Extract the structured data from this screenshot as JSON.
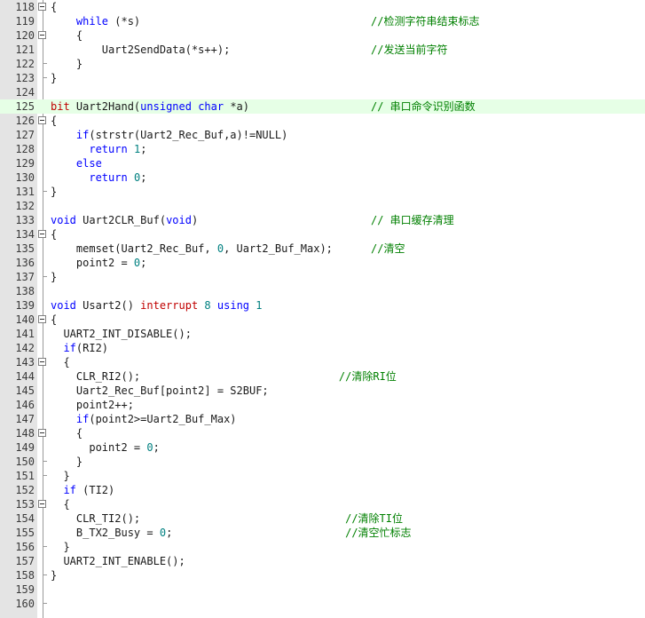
{
  "colors": {
    "keyword": "#0000ff",
    "keyword_red": "#c00000",
    "number": "#008080",
    "comment": "#008000",
    "highlight": "#e6ffe6",
    "gutter": "#e4e4e4"
  },
  "highlighted_line": 125,
  "lines": [
    {
      "n": "118",
      "fold": "open",
      "tokens": [
        {
          "t": "{"
        }
      ]
    },
    {
      "n": "119",
      "tokens": [
        {
          "t": "    "
        },
        {
          "t": "while",
          "c": "kw"
        },
        {
          "t": " (*s)"
        }
      ],
      "comment": "//检测字符串结束标志",
      "cc": 50
    },
    {
      "n": "120",
      "fold": "open",
      "tokens": [
        {
          "t": "    {"
        }
      ]
    },
    {
      "n": "121",
      "tokens": [
        {
          "t": "        Uart2SendData(*s++);"
        }
      ],
      "comment": "//发送当前字符",
      "cc": 50
    },
    {
      "n": "122",
      "fold": "end",
      "tokens": [
        {
          "t": "    }"
        }
      ]
    },
    {
      "n": "123",
      "fold": "end",
      "tokens": [
        {
          "t": "}"
        }
      ]
    },
    {
      "n": "124",
      "tokens": []
    },
    {
      "n": "125",
      "tokens": [
        {
          "t": "bit",
          "c": "kwr"
        },
        {
          "t": " Uart2Hand("
        },
        {
          "t": "unsigned",
          "c": "kw"
        },
        {
          "t": " "
        },
        {
          "t": "char",
          "c": "kw"
        },
        {
          "t": " *a)"
        }
      ],
      "comment": "// 串口命令识别函数",
      "cc": 50
    },
    {
      "n": "126",
      "fold": "open",
      "tokens": [
        {
          "t": "{"
        }
      ]
    },
    {
      "n": "127",
      "tokens": [
        {
          "t": "    "
        },
        {
          "t": "if",
          "c": "kw"
        },
        {
          "t": "(strstr(Uart2_Rec_Buf,a)!=NULL)"
        }
      ]
    },
    {
      "n": "128",
      "tokens": [
        {
          "t": "      "
        },
        {
          "t": "return",
          "c": "kw"
        },
        {
          "t": " "
        },
        {
          "t": "1",
          "c": "num"
        },
        {
          "t": ";"
        }
      ]
    },
    {
      "n": "129",
      "tokens": [
        {
          "t": "    "
        },
        {
          "t": "else",
          "c": "kw"
        }
      ]
    },
    {
      "n": "130",
      "tokens": [
        {
          "t": "      "
        },
        {
          "t": "return",
          "c": "kw"
        },
        {
          "t": " "
        },
        {
          "t": "0",
          "c": "num"
        },
        {
          "t": ";"
        }
      ]
    },
    {
      "n": "131",
      "fold": "end",
      "tokens": [
        {
          "t": "}"
        }
      ]
    },
    {
      "n": "132",
      "tokens": []
    },
    {
      "n": "133",
      "tokens": [
        {
          "t": "void",
          "c": "kw"
        },
        {
          "t": " Uart2CLR_Buf("
        },
        {
          "t": "void",
          "c": "kw"
        },
        {
          "t": ")"
        }
      ],
      "comment": "// 串口缓存清理",
      "cc": 50
    },
    {
      "n": "134",
      "fold": "open",
      "tokens": [
        {
          "t": "{"
        }
      ]
    },
    {
      "n": "135",
      "tokens": [
        {
          "t": "    memset(Uart2_Rec_Buf, "
        },
        {
          "t": "0",
          "c": "num"
        },
        {
          "t": ", Uart2_Buf_Max);"
        }
      ],
      "comment": "//清空",
      "cc": 50
    },
    {
      "n": "136",
      "tokens": [
        {
          "t": "    point2 = "
        },
        {
          "t": "0",
          "c": "num"
        },
        {
          "t": ";"
        }
      ]
    },
    {
      "n": "137",
      "fold": "end",
      "tokens": [
        {
          "t": "}"
        }
      ]
    },
    {
      "n": "138",
      "tokens": []
    },
    {
      "n": "139",
      "tokens": [
        {
          "t": "void",
          "c": "kw"
        },
        {
          "t": " Usart2() "
        },
        {
          "t": "interrupt",
          "c": "kwr"
        },
        {
          "t": " "
        },
        {
          "t": "8",
          "c": "num"
        },
        {
          "t": " "
        },
        {
          "t": "using",
          "c": "kw"
        },
        {
          "t": " "
        },
        {
          "t": "1",
          "c": "num"
        }
      ]
    },
    {
      "n": "140",
      "fold": "open",
      "tokens": [
        {
          "t": "{"
        }
      ]
    },
    {
      "n": "141",
      "tokens": [
        {
          "t": "  UART2_INT_DISABLE();"
        }
      ]
    },
    {
      "n": "142",
      "tokens": [
        {
          "t": "  "
        },
        {
          "t": "if",
          "c": "kw"
        },
        {
          "t": "(RI2)"
        }
      ]
    },
    {
      "n": "143",
      "fold": "open",
      "tokens": [
        {
          "t": "  {"
        }
      ]
    },
    {
      "n": "144",
      "tokens": [
        {
          "t": "    CLR_RI2();"
        }
      ],
      "comment": "//清除RI位",
      "cc": 45
    },
    {
      "n": "145",
      "tokens": [
        {
          "t": "    Uart2_Rec_Buf[point2] = S2BUF;"
        }
      ]
    },
    {
      "n": "146",
      "tokens": [
        {
          "t": "    point2++;"
        }
      ]
    },
    {
      "n": "147",
      "tokens": [
        {
          "t": "    "
        },
        {
          "t": "if",
          "c": "kw"
        },
        {
          "t": "(point2>=Uart2_Buf_Max)"
        }
      ]
    },
    {
      "n": "148",
      "fold": "open",
      "tokens": [
        {
          "t": "    {"
        }
      ]
    },
    {
      "n": "149",
      "tokens": [
        {
          "t": "      point2 = "
        },
        {
          "t": "0",
          "c": "num"
        },
        {
          "t": ";"
        }
      ]
    },
    {
      "n": "150",
      "fold": "end",
      "tokens": [
        {
          "t": "    }"
        }
      ]
    },
    {
      "n": "151",
      "fold": "end",
      "tokens": [
        {
          "t": "  }"
        }
      ]
    },
    {
      "n": "152",
      "tokens": [
        {
          "t": "  "
        },
        {
          "t": "if",
          "c": "kw"
        },
        {
          "t": " (TI2)"
        }
      ]
    },
    {
      "n": "153",
      "fold": "open",
      "tokens": [
        {
          "t": "  {"
        }
      ]
    },
    {
      "n": "154",
      "tokens": [
        {
          "t": "    CLR_TI2();"
        }
      ],
      "comment": "//清除TI位",
      "cc": 46
    },
    {
      "n": "155",
      "tokens": [
        {
          "t": "    B_TX2_Busy = "
        },
        {
          "t": "0",
          "c": "num"
        },
        {
          "t": ";"
        }
      ],
      "comment": "//清空忙标志",
      "cc": 46
    },
    {
      "n": "156",
      "fold": "end",
      "tokens": [
        {
          "t": "  }"
        }
      ]
    },
    {
      "n": "157",
      "tokens": [
        {
          "t": "  UART2_INT_ENABLE();"
        }
      ]
    },
    {
      "n": "158",
      "fold": "end",
      "tokens": [
        {
          "t": "}"
        }
      ]
    },
    {
      "n": "159",
      "tokens": []
    },
    {
      "n": "160",
      "fold": "end",
      "tokens": []
    }
  ]
}
